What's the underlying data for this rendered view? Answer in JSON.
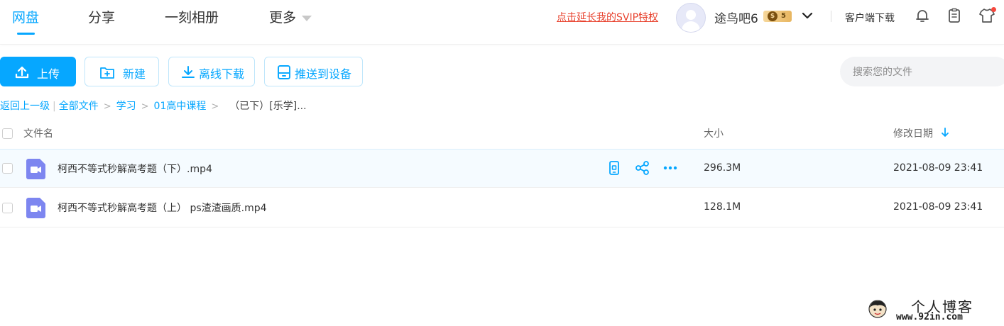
{
  "nav": {
    "tabs": [
      {
        "label": "网盘",
        "active": true
      },
      {
        "label": "分享",
        "active": false
      },
      {
        "label": "一刻相册",
        "active": false
      },
      {
        "label": "更多",
        "active": false
      }
    ],
    "accent_color": "#06a7ff"
  },
  "header": {
    "svip_promo": "点击延长我的SVIP特权",
    "username": "途鸟吧6",
    "svip_level": "5",
    "client_download": "客户端下载",
    "icons": [
      "bell-icon",
      "clipboard-icon",
      "shirt-icon"
    ]
  },
  "toolbar": {
    "upload_label": "上传",
    "new_label": "新建",
    "offline_download_label": "离线下载",
    "push_to_device_label": "推送到设备"
  },
  "search": {
    "placeholder": "搜索您的文件"
  },
  "breadcrumb": {
    "back": "返回上一级",
    "separator": "|",
    "items": [
      "全部文件",
      "学习",
      "01高中课程"
    ],
    "current": "（已下）[乐学]..."
  },
  "table": {
    "columns": {
      "name": "文件名",
      "size": "大小",
      "modified": "修改日期"
    },
    "sort": {
      "column": "modified",
      "direction": "desc"
    },
    "rows": [
      {
        "name": "柯西不等式秒解高考题（下）.mp4",
        "size": "296.3M",
        "modified": "2021-08-09 23:41",
        "type": "video",
        "hovered": true
      },
      {
        "name": "柯西不等式秒解高考题（上） ps渣渣画质.mp4",
        "size": "128.1M",
        "modified": "2021-08-09 23:41",
        "type": "video",
        "hovered": false
      }
    ]
  },
  "watermark": {
    "title": "个人博客",
    "url": "www.92in.com"
  },
  "colors": {
    "accent": "#06a7ff",
    "promo": "#e8432f",
    "file_icon": "#7d86f0"
  }
}
